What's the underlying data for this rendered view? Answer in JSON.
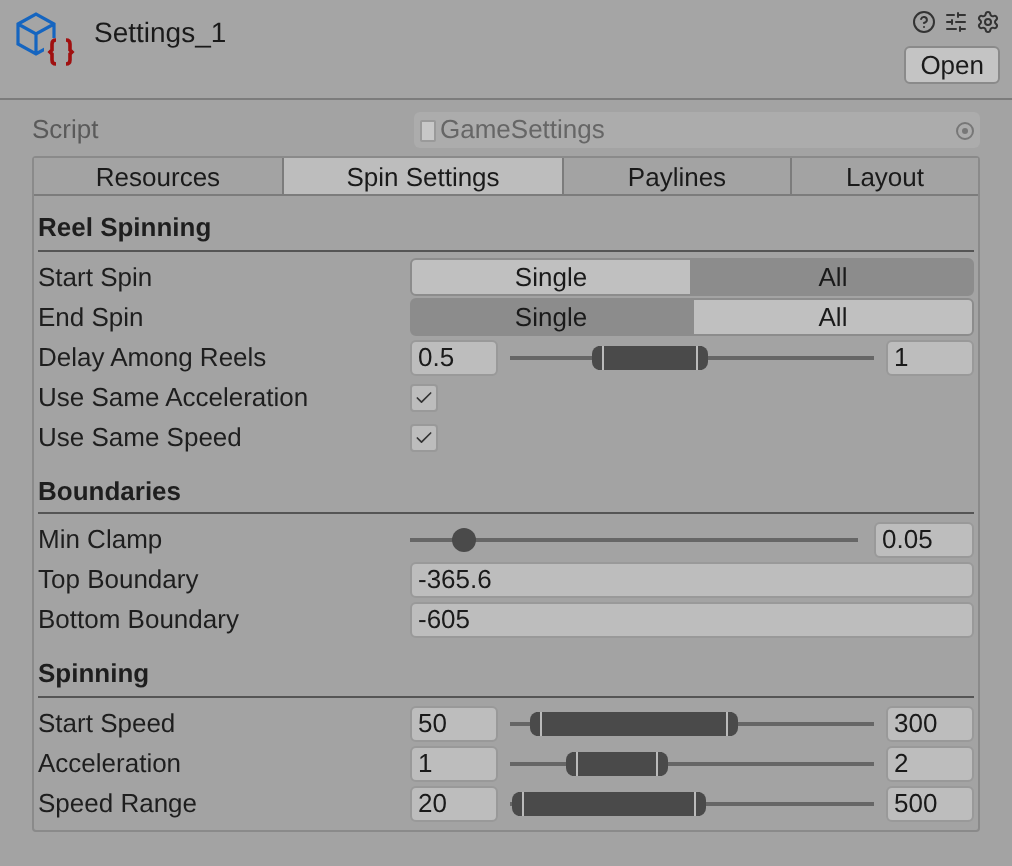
{
  "header": {
    "title": "Settings_1",
    "open_button": "Open"
  },
  "script": {
    "label": "Script",
    "value": "GameSettings"
  },
  "tabs": [
    {
      "label": "Resources",
      "selected": false
    },
    {
      "label": "Spin Settings",
      "selected": true
    },
    {
      "label": "Paylines",
      "selected": false
    },
    {
      "label": "Layout",
      "selected": false
    }
  ],
  "sections": [
    {
      "title": "Reel Spinning",
      "rows": [
        {
          "kind": "toggle",
          "label": "Start Spin",
          "options": [
            {
              "label": "Single",
              "selected": false
            },
            {
              "label": "All",
              "selected": true
            }
          ]
        },
        {
          "kind": "toggle",
          "label": "End Spin",
          "options": [
            {
              "label": "Single",
              "selected": true
            },
            {
              "label": "All",
              "selected": false
            }
          ]
        },
        {
          "kind": "minmax",
          "label": "Delay Among Reels",
          "min": "0.5",
          "max": "1",
          "handles": [
            {
              "level": 0.24
            },
            {
              "level": 0.53
            }
          ]
        },
        {
          "kind": "checkbox",
          "label": "Use Same Acceleration",
          "checked": true
        },
        {
          "kind": "checkbox",
          "label": "Use Same Speed",
          "checked": true
        }
      ]
    },
    {
      "title": "Boundaries",
      "rows": [
        {
          "kind": "slider",
          "label": "Min Clamp",
          "value": "0.05",
          "level": 0.12
        },
        {
          "kind": "field",
          "label": "Top Boundary",
          "value": "-365.6"
        },
        {
          "kind": "field",
          "label": "Bottom Boundary",
          "value": "-605"
        }
      ]
    },
    {
      "title": "Spinning",
      "rows": [
        {
          "kind": "minmax",
          "label": "Start Speed",
          "min": "50",
          "max": "300",
          "handles": [
            {
              "level": 0.07
            },
            {
              "level": 0.61
            }
          ]
        },
        {
          "kind": "minmax",
          "label": "Acceleration",
          "min": "1",
          "max": "2",
          "handles": [
            {
              "level": 0.17
            },
            {
              "level": 0.42
            }
          ]
        },
        {
          "kind": "minmax",
          "label": "Speed Range",
          "min": "20",
          "max": "500",
          "handles": [
            {
              "level": 0.02
            },
            {
              "level": 0.52
            }
          ]
        }
      ]
    }
  ]
}
